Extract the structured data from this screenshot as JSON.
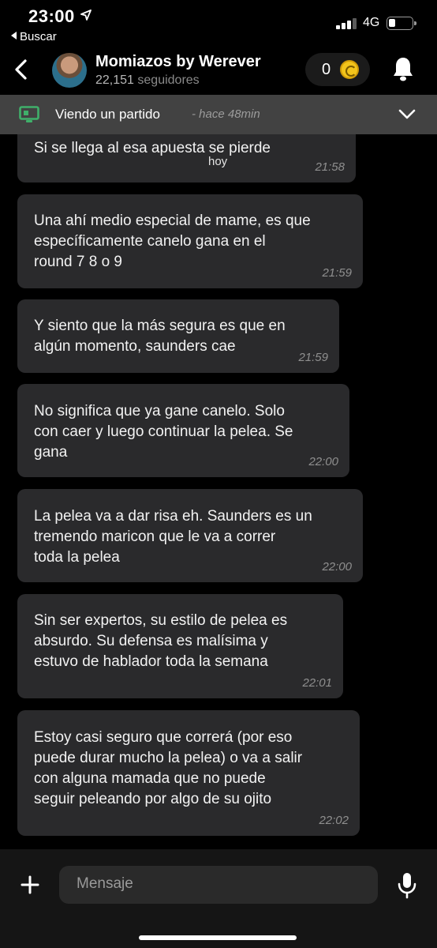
{
  "status_bar": {
    "time": "23:00",
    "back_app": "Buscar",
    "network": "4G",
    "icons": [
      "location-arrow-icon",
      "signal-icon",
      "battery-icon"
    ]
  },
  "header": {
    "title": "Momiazos by Werever",
    "followers_count": "22,151",
    "followers_label": "seguidores",
    "coins": "0"
  },
  "banner": {
    "text": "Viendo un partido",
    "time": "- hace 48min"
  },
  "chat": {
    "date_label": "hoy",
    "messages": [
      {
        "text": "Si se llega al esa apuesta se pierde",
        "time": "21:58"
      },
      {
        "text": "Una ahí medio especial de mame, es que\nespecíficamente canelo gana en el\nround 7 8 o 9",
        "time": "21:59"
      },
      {
        "text": "Y siento que la más segura es que en\nalgún momento, saunders cae",
        "time": "21:59"
      },
      {
        "text": "No significa que ya gane canelo. Solo\ncon caer y luego continuar la pelea. Se\ngana",
        "time": "22:00"
      },
      {
        "text": "La pelea va a dar risa eh. Saunders es un\ntremendo maricon que le va a correr\ntoda la pelea",
        "time": "22:00"
      },
      {
        "text": "Sin ser expertos, su estilo de pelea es\nabsurdo. Su defensa es malísima y\nestuvo de hablador toda la semana",
        "time": "22:01"
      },
      {
        "text": "Estoy casi seguro que correrá (por eso\npuede durar mucho la pelea) o va a salir\ncon alguna mamada que no puede\nseguir peleando por algo de su ojito",
        "time": "22:02"
      }
    ]
  },
  "composer": {
    "placeholder": "Mensaje"
  },
  "colors": {
    "background": "#000000",
    "bubble": "#2a2a2c",
    "banner": "#424242",
    "banner_icon": "#3fb06a",
    "coin": "#f3c41b"
  }
}
